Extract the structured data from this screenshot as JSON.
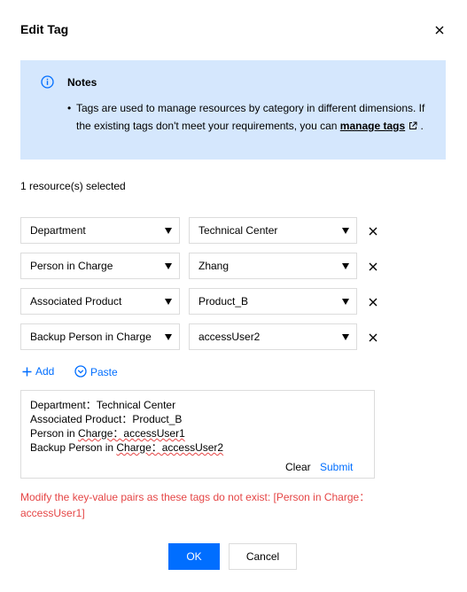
{
  "dialog": {
    "title": "Edit Tag"
  },
  "notes": {
    "title": "Notes",
    "text_before_link": "Tags are used to manage resources by category in different dimensions. If the existing tags don't meet your requirements, you can ",
    "link_label": "manage tags",
    "text_after_link": " ."
  },
  "selection": {
    "count_text": "1 resource(s) selected"
  },
  "tag_rows": [
    {
      "key": "Department",
      "value": "Technical Center"
    },
    {
      "key": "Person in Charge",
      "value": "Zhang"
    },
    {
      "key": "Associated Product",
      "value": "Product_B"
    },
    {
      "key": "Backup Person in Charge",
      "value": "accessUser2"
    }
  ],
  "actions": {
    "add_label": "Add",
    "paste_label": "Paste"
  },
  "paste_box": {
    "line1": "Department：Technical Center",
    "line2": "Associated Product：Product_B",
    "line3_pre": "Person in ",
    "line3_wavy": "Charge：accessUser1",
    "line4_pre": "Backup Person in ",
    "line4_wavy": "Charge：accessUser2",
    "clear_label": "Clear",
    "submit_label": "Submit"
  },
  "error": {
    "message": "Modify the key-value pairs as these tags do not exist: [Person in Charge：accessUser1]"
  },
  "footer": {
    "ok_label": "OK",
    "cancel_label": "Cancel"
  },
  "colors": {
    "primary": "#006eff",
    "notes_bg": "#d5e7fd",
    "error": "#e54545",
    "border": "#dcdcdc"
  }
}
